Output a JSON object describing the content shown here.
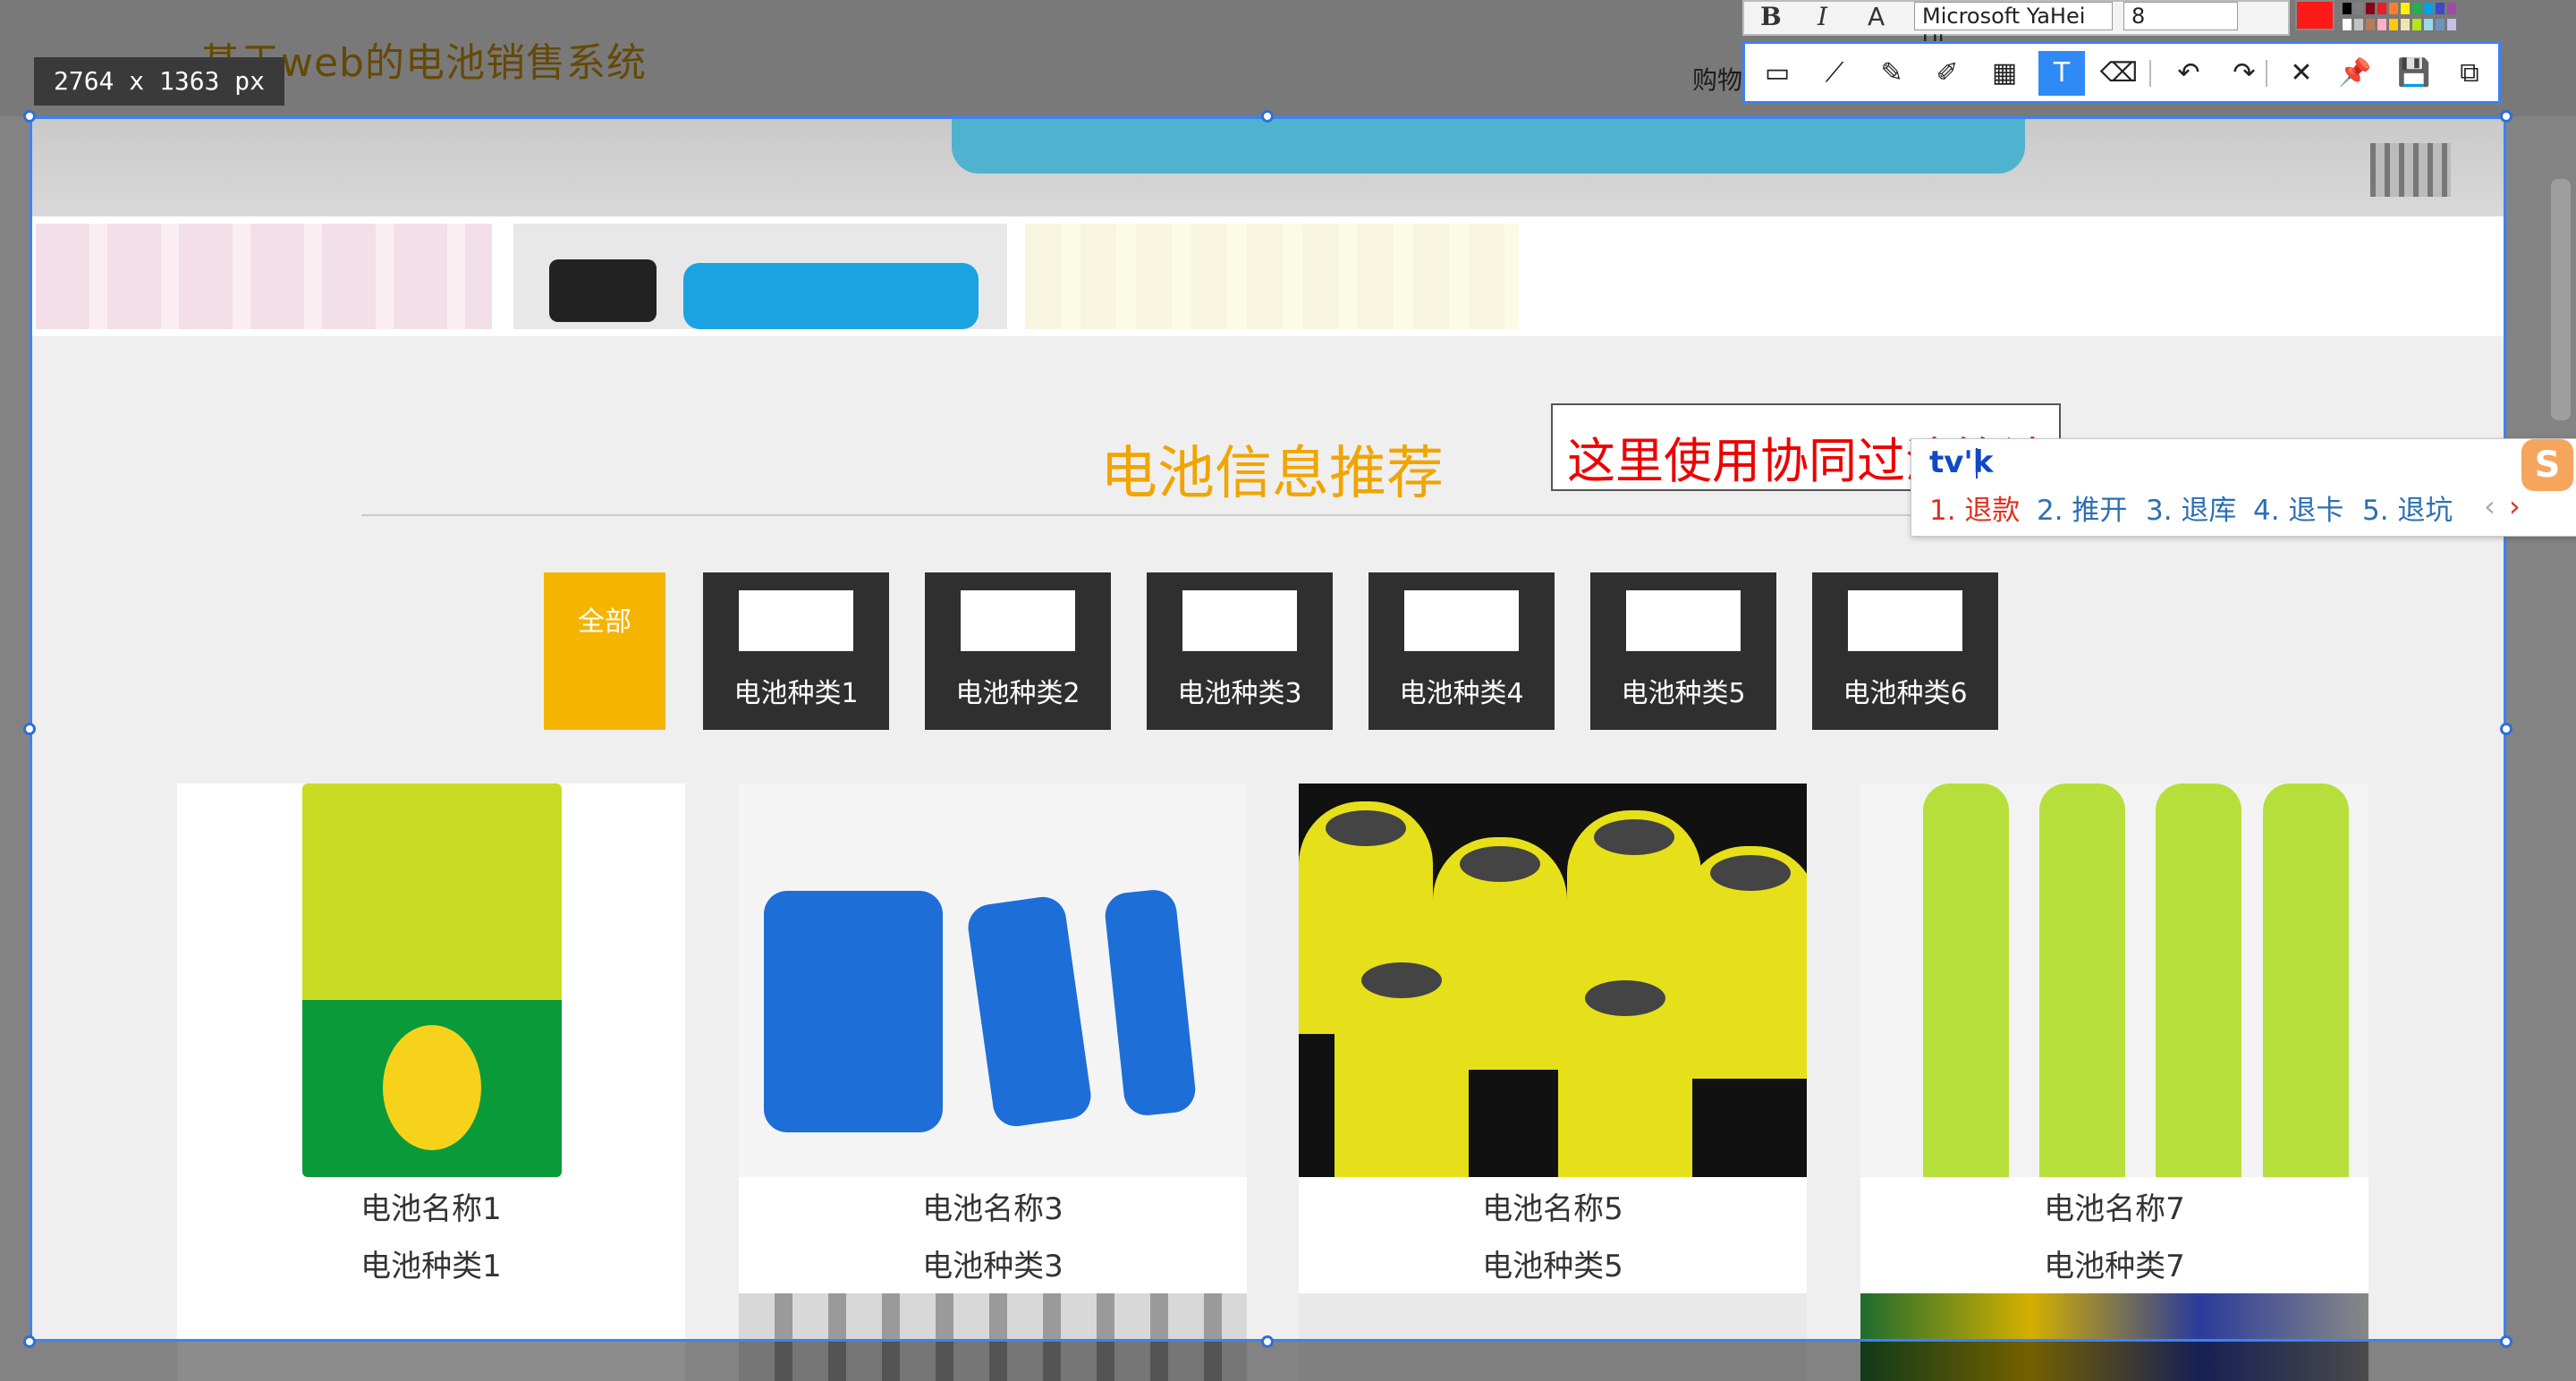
{
  "site": {
    "title": "基于web的电池销售系统",
    "cart": "购物"
  },
  "capture": {
    "dimensions": "2764 x 1363  px"
  },
  "section": {
    "title": "电池信息推荐"
  },
  "annotation": {
    "text": "这里使用协同过滤算法"
  },
  "categories": [
    {
      "label": "全部",
      "active": true
    },
    {
      "label": "电池种类1"
    },
    {
      "label": "电池种类2"
    },
    {
      "label": "电池种类3"
    },
    {
      "label": "电池种类4"
    },
    {
      "label": "电池种类5"
    },
    {
      "label": "电池种类6"
    }
  ],
  "products": [
    {
      "name": "电池名称1",
      "type": "电池种类1"
    },
    {
      "name": "电池名称3",
      "type": "电池种类3"
    },
    {
      "name": "电池名称5",
      "type": "电池种类5"
    },
    {
      "name": "电池名称7",
      "type": "电池种类7"
    }
  ],
  "format_bar": {
    "bold": "B",
    "italic": "I",
    "font_icon": "A",
    "font": "Microsoft YaHei UI",
    "size": "8"
  },
  "colors": {
    "current": "#ff1a1a",
    "accent": "#f4b400",
    "selection": "#3b82f6",
    "annotation_text": "#ee0000",
    "swatches": [
      "#000000",
      "#7f7f7f",
      "#880015",
      "#ed1c24",
      "#ff7f27",
      "#fff200",
      "#22b14c",
      "#00a2e8",
      "#3f48cc",
      "#a349a4",
      "#ffffff",
      "#c3c3c3",
      "#b97a57",
      "#ffaec9",
      "#ffc90e",
      "#efe4b0",
      "#b5e61d",
      "#99d9ea",
      "#7092be",
      "#c8bfe7"
    ]
  },
  "tools": [
    {
      "name": "rectangle-icon",
      "glyph": "▭"
    },
    {
      "name": "polyline-icon",
      "glyph": "⟋"
    },
    {
      "name": "pen-icon",
      "glyph": "✎"
    },
    {
      "name": "highlighter-icon",
      "glyph": "✐"
    },
    {
      "name": "mosaic-icon",
      "glyph": "▦"
    },
    {
      "name": "text-icon",
      "glyph": "T",
      "selected": true
    },
    {
      "name": "eraser-icon",
      "glyph": "⌫"
    },
    {
      "name": "undo-icon",
      "glyph": "↶"
    },
    {
      "name": "redo-icon",
      "glyph": "↷"
    },
    {
      "name": "close-icon",
      "glyph": "✕"
    },
    {
      "name": "pin-icon",
      "glyph": "📌"
    },
    {
      "name": "save-icon",
      "glyph": "💾"
    },
    {
      "name": "copy-icon",
      "glyph": "⧉"
    }
  ],
  "ime": {
    "composition": "tv'k",
    "candidates": [
      "1. 退款",
      "2. 推开",
      "3. 退库",
      "4. 退卡",
      "5. 退坑"
    ],
    "logo": "S",
    "prev": "‹",
    "next": "›"
  }
}
